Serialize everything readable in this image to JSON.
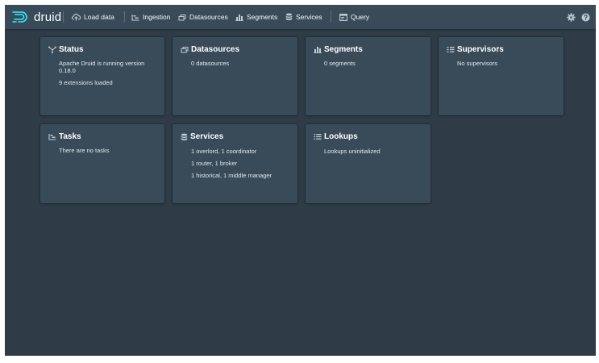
{
  "app": {
    "logo_text": "druid"
  },
  "nav": {
    "items": [
      {
        "label": "Load data",
        "icon": "cloud-upload-icon"
      },
      {
        "label": "Ingestion",
        "icon": "gantt-chart-icon"
      },
      {
        "label": "Datasources",
        "icon": "multi-select-icon"
      },
      {
        "label": "Segments",
        "icon": "stacked-chart-icon"
      },
      {
        "label": "Services",
        "icon": "database-icon"
      },
      {
        "label": "Query",
        "icon": "application-icon"
      }
    ],
    "right_icons": [
      "settings-icon",
      "help-icon"
    ]
  },
  "cards": {
    "status": {
      "title": "Status",
      "icon": "graph-icon",
      "lines": [
        "Apache Druid is running version",
        "0.18.0",
        "9 extensions loaded"
      ]
    },
    "datasources": {
      "title": "Datasources",
      "icon": "multi-select-icon",
      "lines": [
        "0 datasources"
      ]
    },
    "segments": {
      "title": "Segments",
      "icon": "stacked-chart-icon",
      "lines": [
        "0 segments"
      ]
    },
    "supervisors": {
      "title": "Supervisors",
      "icon": "list-columns-icon",
      "lines": [
        "No supervisors"
      ]
    },
    "tasks": {
      "title": "Tasks",
      "icon": "gantt-chart-icon",
      "lines": [
        "There are no tasks"
      ]
    },
    "services": {
      "title": "Services",
      "icon": "database-icon",
      "lines": [
        "1 overlord, 1 coordinator",
        "1 router, 1 broker",
        "1 historical, 1 middle manager"
      ]
    },
    "lookups": {
      "title": "Lookups",
      "icon": "properties-icon",
      "lines": [
        "Lookups uninitialized"
      ]
    }
  },
  "colors": {
    "background": "#2f3b47",
    "navbar": "#394b59",
    "card": "#394b59",
    "text": "#f5f8fa"
  }
}
